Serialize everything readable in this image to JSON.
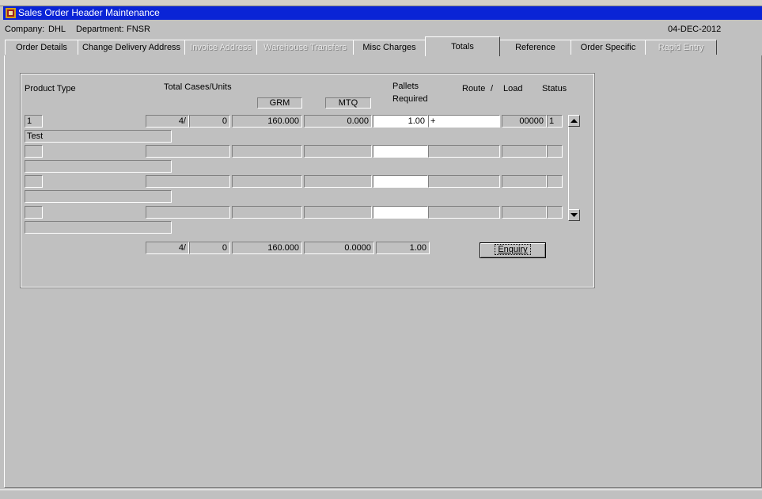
{
  "window": {
    "title": "Sales Order Header Maintenance",
    "icon": "app-icon"
  },
  "info": {
    "company_label": "Company:",
    "company": "DHL",
    "department_label": "Department:",
    "department": "FNSR",
    "date": "04-DEC-2012"
  },
  "tabs": [
    {
      "label": "Order Details",
      "state": "normal"
    },
    {
      "label": "Change Delivery Address",
      "state": "normal"
    },
    {
      "label": "Invoice Address",
      "state": "disabled"
    },
    {
      "label": "Warehouse Transfers",
      "state": "disabled"
    },
    {
      "label": "Misc Charges",
      "state": "normal"
    },
    {
      "label": "Totals",
      "state": "active"
    },
    {
      "label": "Reference",
      "state": "normal"
    },
    {
      "label": "Order Specific",
      "state": "normal"
    },
    {
      "label": "Rapid Entry",
      "state": "disabled"
    }
  ],
  "headers": {
    "product_type": "Product Type",
    "total_cases_units": "Total Cases/Units",
    "grm": "GRM",
    "mtq": "MTQ",
    "pallets": "Pallets",
    "required": "Required",
    "route": "Route",
    "slash": "/",
    "load": "Load",
    "status": "Status"
  },
  "rows": [
    {
      "product_type": "1",
      "cases": "4/",
      "units": "0",
      "grm": "160.000",
      "mtq": "0.000",
      "pallets": "1.00",
      "route": "+",
      "load": "00000",
      "status": "1",
      "description": "Test"
    },
    {
      "product_type": "",
      "cases": "",
      "units": "",
      "grm": "",
      "mtq": "",
      "pallets": "",
      "route": "",
      "load": "",
      "status": "",
      "description": ""
    },
    {
      "product_type": "",
      "cases": "",
      "units": "",
      "grm": "",
      "mtq": "",
      "pallets": "",
      "route": "",
      "load": "",
      "status": "",
      "description": ""
    },
    {
      "product_type": "",
      "cases": "",
      "units": "",
      "grm": "",
      "mtq": "",
      "pallets": "",
      "route": "",
      "load": "",
      "status": "",
      "description": ""
    }
  ],
  "totals": {
    "cases": "4/",
    "units": "0",
    "grm": "160.000",
    "mtq": "0.0000",
    "pallets": "1.00"
  },
  "buttons": {
    "enquiry": "Enquiry"
  }
}
